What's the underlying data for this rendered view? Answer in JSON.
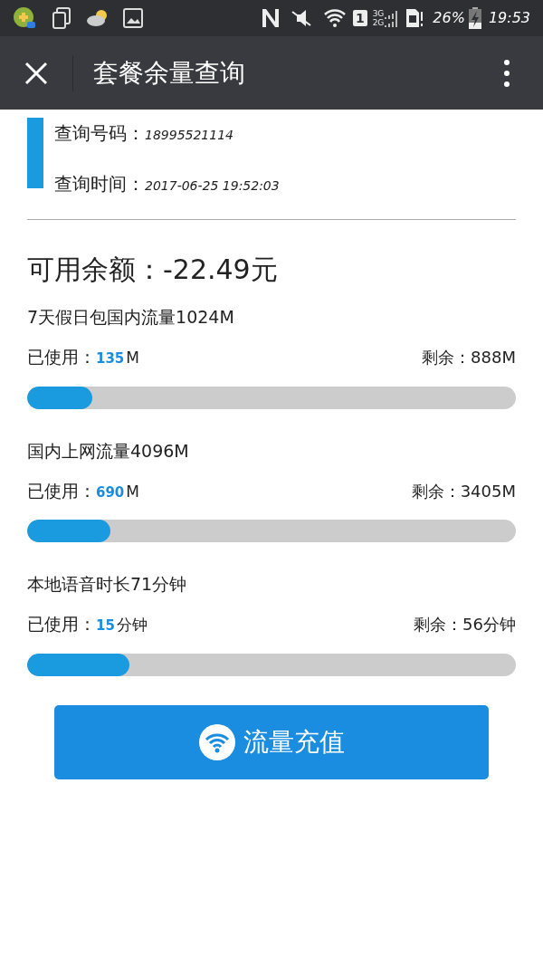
{
  "status_bar": {
    "sim_slot": "1",
    "network_top": "3G",
    "network_bottom": "2G",
    "battery": "26%",
    "time": "19:53"
  },
  "header": {
    "title": "套餐余量查询"
  },
  "query_info": [
    {
      "label": "查询号码：",
      "value": "18995521114"
    },
    {
      "label": "查询时间：",
      "value": "2017-06-25 19:52:03"
    }
  ],
  "balance": "可用余额：-22.49元",
  "packages": [
    {
      "name": "7天假日包国内流量1024M",
      "used_label": "已使用：",
      "used": "135",
      "unit": "M",
      "remaining": "剩余：888M",
      "level": 0.133
    },
    {
      "name": "国内上网流量4096M",
      "used_label": "已使用：",
      "used": "690",
      "unit": "M",
      "remaining": "剩余：3405M",
      "level": 0.17
    },
    {
      "name": "本地语音时长71分钟",
      "used_label": "已使用：",
      "used": "15",
      "unit": "分钟",
      "remaining": "剩余：56分钟",
      "level": 0.21
    }
  ],
  "recharge_button": "流量充值"
}
